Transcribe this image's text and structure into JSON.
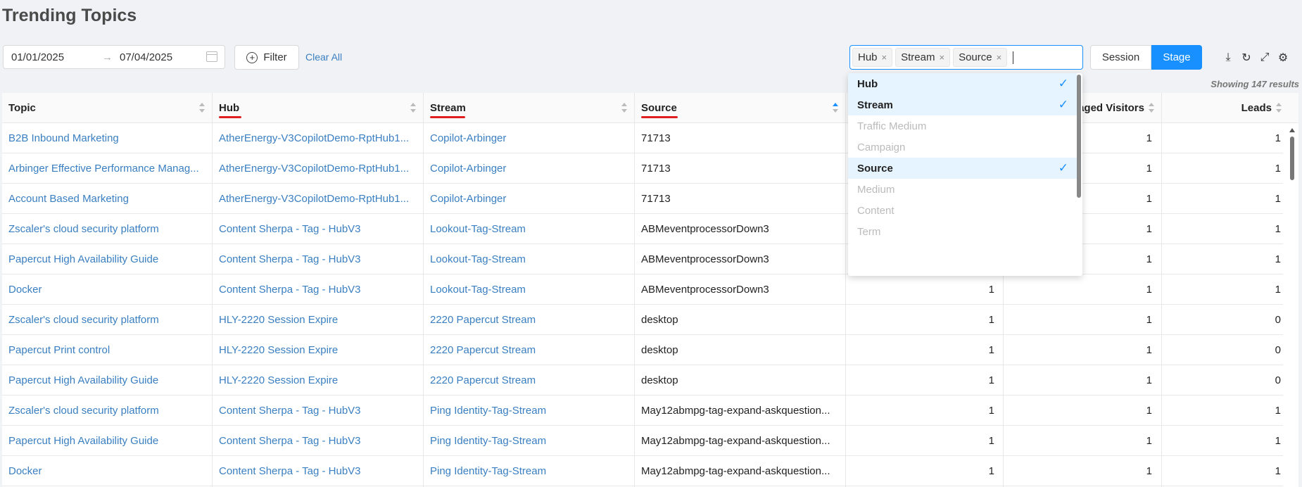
{
  "title": "Trending Topics",
  "date_start": "01/01/2025",
  "date_arrow": "→",
  "date_end": "07/04/2025",
  "filter_label": "Filter",
  "filter_icon": "+",
  "clear_all": "Clear All",
  "tags": [
    "Hub",
    "Stream",
    "Source"
  ],
  "tag_close": "×",
  "toggle": {
    "session": "Session",
    "stage": "Stage"
  },
  "toolbar_icons": {
    "download": "⤓",
    "refresh": "↻",
    "fullscreen": "⤢",
    "settings": "⚙"
  },
  "results": "Showing 147 results",
  "columns": {
    "topic": "Topic",
    "hub": "Hub",
    "stream": "Stream",
    "source": "Source",
    "engaged": "aged Visitors",
    "leads": "Leads"
  },
  "rows": [
    {
      "topic": "B2B Inbound Marketing",
      "hub": "AtherEnergy-V3CopilotDemo-RptHub1...",
      "stream": "Copilot-Arbinger",
      "source": "71713",
      "v1": "",
      "v2": "1",
      "leads": "1"
    },
    {
      "topic": "Arbinger Effective Performance Manag...",
      "hub": "AtherEnergy-V3CopilotDemo-RptHub1...",
      "stream": "Copilot-Arbinger",
      "source": "71713",
      "v1": "",
      "v2": "1",
      "leads": "1"
    },
    {
      "topic": "Account Based Marketing",
      "hub": "AtherEnergy-V3CopilotDemo-RptHub1...",
      "stream": "Copilot-Arbinger",
      "source": "71713",
      "v1": "",
      "v2": "1",
      "leads": "1"
    },
    {
      "topic": "Zscaler's cloud security platform",
      "hub": "Content Sherpa - Tag - HubV3",
      "stream": "Lookout-Tag-Stream",
      "source": "ABMeventprocessorDown3",
      "v1": "",
      "v2": "1",
      "leads": "1"
    },
    {
      "topic": "Papercut High Availability Guide",
      "hub": "Content Sherpa - Tag - HubV3",
      "stream": "Lookout-Tag-Stream",
      "source": "ABMeventprocessorDown3",
      "v1": "",
      "v2": "1",
      "leads": "1"
    },
    {
      "topic": "Docker",
      "hub": "Content Sherpa - Tag - HubV3",
      "stream": "Lookout-Tag-Stream",
      "source": "ABMeventprocessorDown3",
      "v1": "1",
      "v2": "1",
      "leads": "1"
    },
    {
      "topic": "Zscaler's cloud security platform",
      "hub": "HLY-2220 Session Expire",
      "stream": "2220 Papercut Stream",
      "source": "desktop",
      "v1": "1",
      "v2": "1",
      "leads": "0"
    },
    {
      "topic": "Papercut Print control",
      "hub": "HLY-2220 Session Expire",
      "stream": "2220 Papercut Stream",
      "source": "desktop",
      "v1": "1",
      "v2": "1",
      "leads": "0"
    },
    {
      "topic": "Papercut High Availability Guide",
      "hub": "HLY-2220 Session Expire",
      "stream": "2220 Papercut Stream",
      "source": "desktop",
      "v1": "1",
      "v2": "1",
      "leads": "0"
    },
    {
      "topic": "Zscaler's cloud security platform",
      "hub": "Content Sherpa - Tag - HubV3",
      "stream": "Ping Identity-Tag-Stream",
      "source": "May12abmpg-tag-expand-askquestion...",
      "v1": "1",
      "v2": "1",
      "leads": "1"
    },
    {
      "topic": "Papercut High Availability Guide",
      "hub": "Content Sherpa - Tag - HubV3",
      "stream": "Ping Identity-Tag-Stream",
      "source": "May12abmpg-tag-expand-askquestion...",
      "v1": "1",
      "v2": "1",
      "leads": "1"
    },
    {
      "topic": "Docker",
      "hub": "Content Sherpa - Tag - HubV3",
      "stream": "Ping Identity-Tag-Stream",
      "source": "May12abmpg-tag-expand-askquestion...",
      "v1": "1",
      "v2": "1",
      "leads": "1"
    }
  ],
  "dropdown": [
    {
      "label": "Hub",
      "state": "selected"
    },
    {
      "label": "Stream",
      "state": "selected"
    },
    {
      "label": "Traffic Medium",
      "state": "disabled"
    },
    {
      "label": "Campaign",
      "state": "disabled"
    },
    {
      "label": "Source",
      "state": "selected"
    },
    {
      "label": "Medium",
      "state": "disabled"
    },
    {
      "label": "Content",
      "state": "disabled"
    },
    {
      "label": "Term",
      "state": "disabled"
    }
  ],
  "check_mark": "✓"
}
